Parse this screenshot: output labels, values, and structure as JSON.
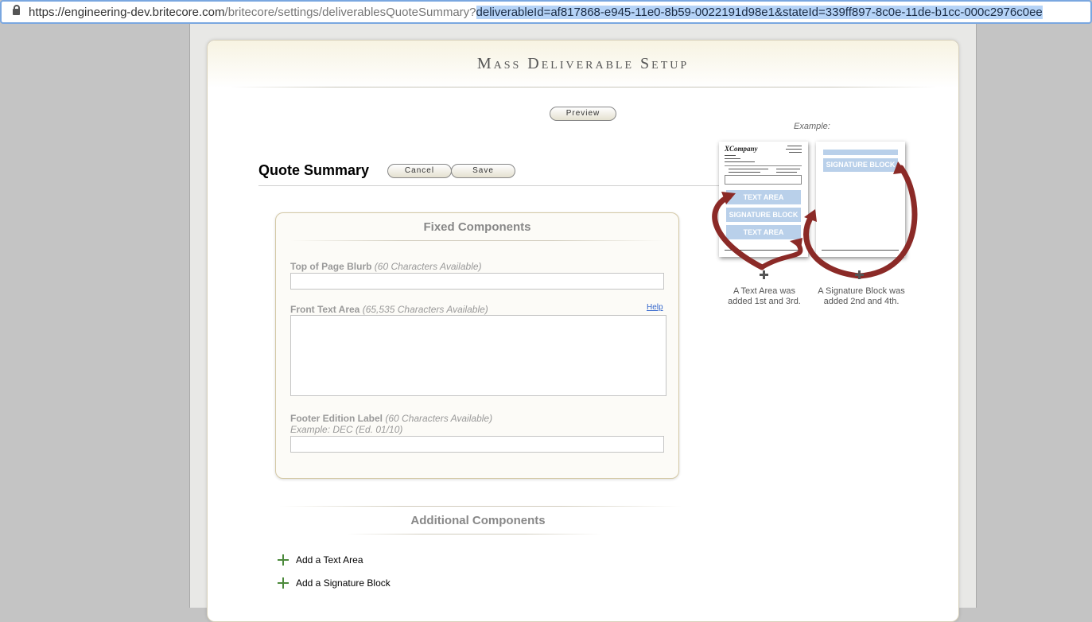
{
  "browser": {
    "url_host": "https://engineering-dev.britecore.com",
    "url_path": "/britecore/settings/deliverablesQuoteSummary?",
    "url_query": "deliverableId=af817868-e945-11e0-8b59-0022191d98e1&stateId=339ff897-8c0e-11de-b1cc-000c2976c0ee"
  },
  "page": {
    "title": "Mass Deliverable Setup"
  },
  "toolbar": {
    "preview_label": "Preview"
  },
  "section": {
    "title": "Quote Summary",
    "cancel_label": "Cancel",
    "save_label": "Save"
  },
  "fixed": {
    "title": "Fixed Components",
    "blurb": {
      "label": "Top of Page Blurb",
      "hint": "(60 Characters Available)",
      "value": ""
    },
    "front_text": {
      "label": "Front Text Area",
      "hint": "(65,535 Characters Available)",
      "value": "",
      "help": "Help"
    },
    "footer": {
      "label": "Footer Edition Label",
      "hint": "(60 Characters Available)",
      "example": "Example: DEC (Ed. 01/10)",
      "value": ""
    }
  },
  "additional": {
    "title": "Additional Components",
    "add_text_area": "Add a Text Area",
    "add_signature_block": "Add a Signature Block"
  },
  "example": {
    "label": "Example:",
    "page1": {
      "logo": "XCompany",
      "blocks": [
        "TEXT AREA",
        "SIGNATURE BLOCK",
        "TEXT AREA"
      ]
    },
    "page2": {
      "blocks": [
        "SIGNATURE BLOCK"
      ]
    },
    "caption_text": "A Text Area was added 1st and 3rd.",
    "caption_signature": "A Signature Block was added 2nd and 4th."
  },
  "colors": {
    "arrow": "#8b2a27",
    "block": "#b9d0ea",
    "plus_green": "#4c8a3c"
  }
}
